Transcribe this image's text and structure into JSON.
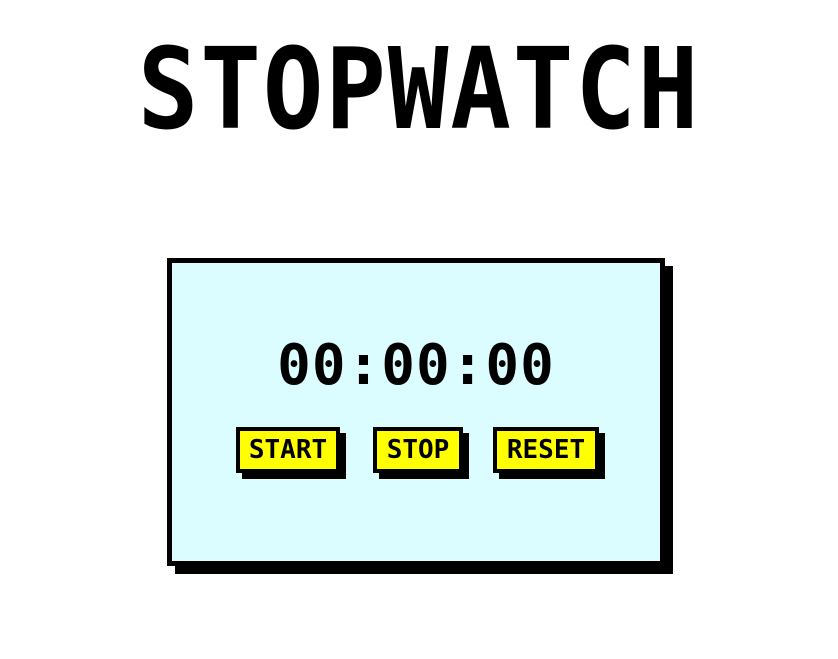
{
  "header": {
    "title": "STOPWATCH"
  },
  "stopwatch": {
    "time": "00:00:00",
    "buttons": {
      "start_label": "START",
      "stop_label": "STOP",
      "reset_label": "RESET"
    }
  },
  "colors": {
    "background": "#ffffff",
    "panel": "#dcfdff",
    "button": "#ffff00",
    "border": "#000000"
  }
}
